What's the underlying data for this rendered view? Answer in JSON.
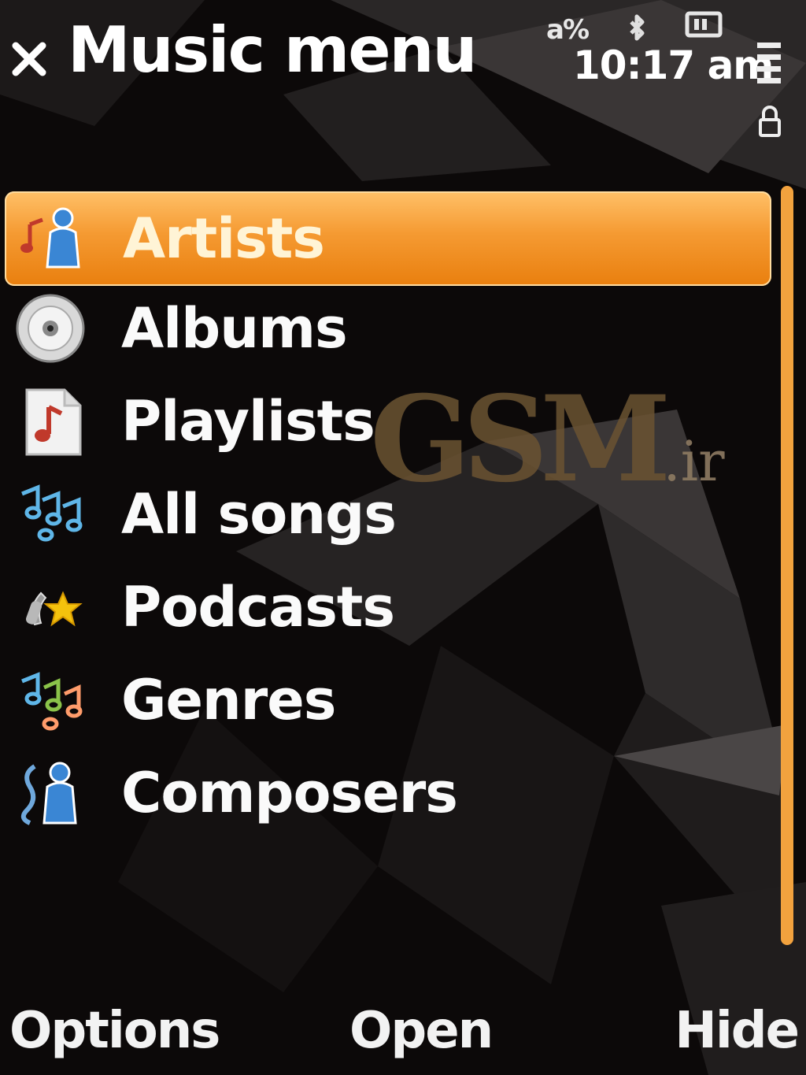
{
  "window": {
    "title": "Music menu"
  },
  "status_bar": {
    "time": "10:17 am",
    "icons": [
      "signal-icon",
      "bluetooth-icon",
      "battery-icon",
      "menu-bars-icon",
      "lock-icon"
    ]
  },
  "list": {
    "selected_index": 0,
    "items": [
      {
        "label": "Artists",
        "icon": "artists-icon"
      },
      {
        "label": "Albums",
        "icon": "album-disc-icon"
      },
      {
        "label": "Playlists",
        "icon": "playlist-icon"
      },
      {
        "label": "All songs",
        "icon": "all-songs-icon"
      },
      {
        "label": "Podcasts",
        "icon": "podcast-icon"
      },
      {
        "label": "Genres",
        "icon": "genres-icon"
      },
      {
        "label": "Composers",
        "icon": "composers-icon"
      }
    ]
  },
  "watermark": {
    "main": "GSM",
    "suffix": ".ir"
  },
  "softkeys": {
    "left": "Options",
    "middle": "Open",
    "right": "Hide"
  },
  "colors": {
    "accent": "#f59a32",
    "background": "#0b0808",
    "text": "#ffffff"
  }
}
